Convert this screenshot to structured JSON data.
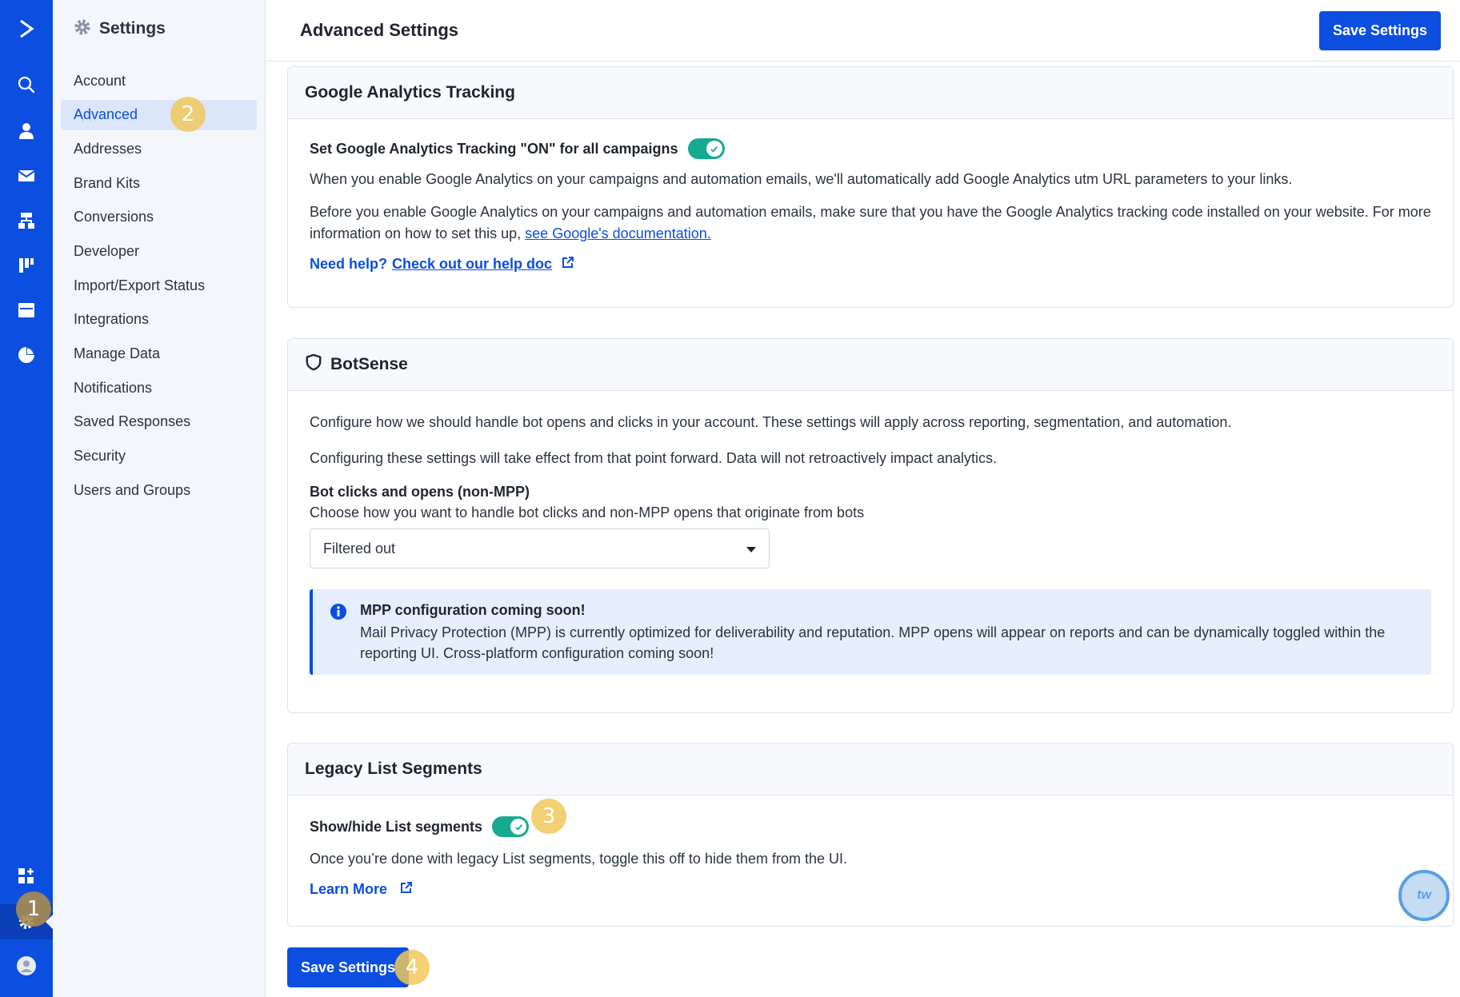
{
  "sidebar": {
    "title": "Settings",
    "items": [
      {
        "label": "Account"
      },
      {
        "label": "Advanced"
      },
      {
        "label": "Addresses"
      },
      {
        "label": "Brand Kits"
      },
      {
        "label": "Conversions"
      },
      {
        "label": "Developer"
      },
      {
        "label": "Import/Export Status"
      },
      {
        "label": "Integrations"
      },
      {
        "label": "Manage Data"
      },
      {
        "label": "Notifications"
      },
      {
        "label": "Saved Responses"
      },
      {
        "label": "Security"
      },
      {
        "label": "Users and Groups"
      }
    ],
    "selected": "Advanced"
  },
  "header": {
    "title": "Advanced Settings",
    "save_label": "Save Settings"
  },
  "ga": {
    "title": "Google Analytics Tracking",
    "toggle_label": "Set Google Analytics Tracking \"ON\" for all campaigns",
    "toggle_on": true,
    "desc1": "When you enable Google Analytics on your campaigns and automation emails, we'll automatically add Google Analytics utm URL parameters to your links.",
    "desc2": "Before you enable Google Analytics on your campaigns and automation emails, make sure that you have the Google Analytics tracking code installed on your website. For more information on how to set this up,",
    "doc_link": "see Google's documentation.",
    "help_prefix": "Need help?",
    "help_link": "Check out our help doc"
  },
  "botsense": {
    "title": "BotSense",
    "desc1": "Configure how we should handle bot opens and clicks in your account. These settings will apply across reporting, segmentation, and automation.",
    "desc2": "Configuring these settings will take effect from that point forward. Data will not retroactively impact analytics.",
    "field_label": "Bot clicks and opens (non-MPP)",
    "field_help": "Choose how you want to handle bot clicks and non-MPP opens that originate from bots",
    "select_value": "Filtered out",
    "info_title": "MPP configuration coming soon!",
    "info_text": "Mail Privacy Protection (MPP) is currently optimized for deliverability and reputation. MPP opens will appear on reports and can be dynamically toggled within the reporting UI. Cross-platform configuration coming soon!"
  },
  "legacy": {
    "title": "Legacy List Segments",
    "toggle_label": "Show/hide List segments",
    "toggle_on": true,
    "desc": "Once you’re done with legacy List segments, toggle this off to hide them from the UI.",
    "learn_more": "Learn More"
  },
  "footer": {
    "save_label": "Save Settings"
  },
  "steps": [
    "1",
    "2",
    "3",
    "4"
  ],
  "chat": {
    "label": "tw"
  },
  "colors": {
    "brand": "#0b4ee0",
    "toggle_on": "#17a991",
    "info_bg": "#e6edfb",
    "step_marker": "#f0c85a"
  }
}
